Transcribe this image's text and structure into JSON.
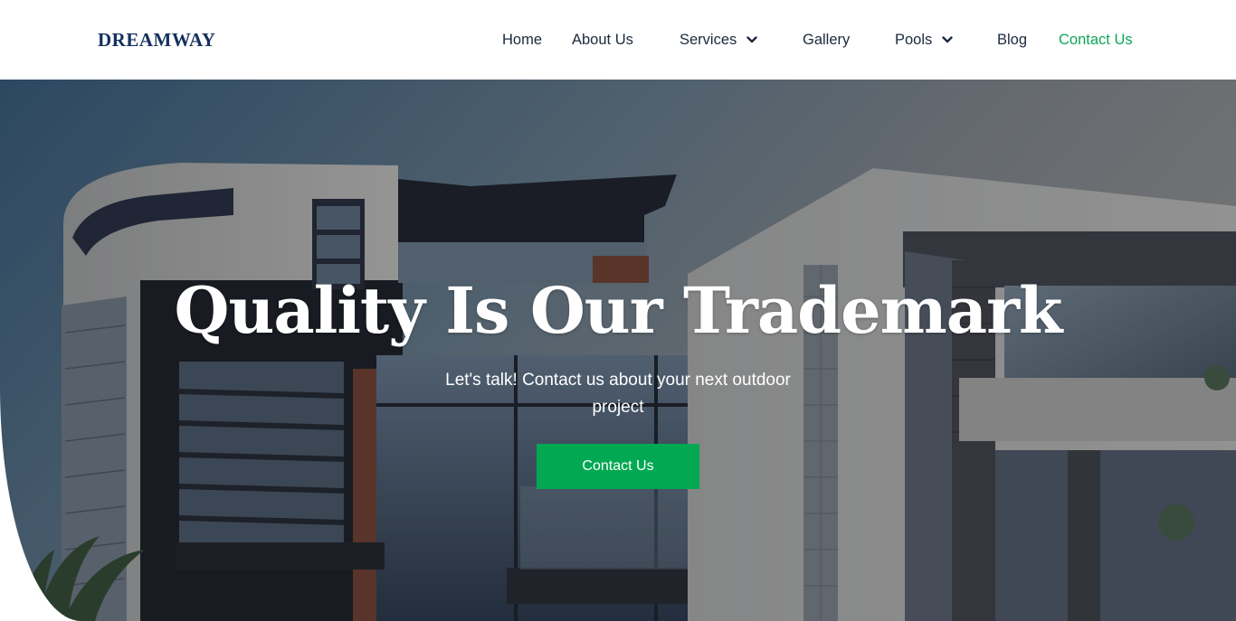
{
  "header": {
    "logo": "DREAMWAY",
    "nav": [
      {
        "label": "Home",
        "dropdown": false,
        "active": false
      },
      {
        "label": "About Us",
        "dropdown": false,
        "active": false
      },
      {
        "label": "Services",
        "dropdown": true,
        "active": false
      },
      {
        "label": "Gallery",
        "dropdown": false,
        "active": false
      },
      {
        "label": "Pools",
        "dropdown": true,
        "active": false
      },
      {
        "label": "Blog",
        "dropdown": false,
        "active": false
      },
      {
        "label": "Contact Us",
        "dropdown": false,
        "active": true
      }
    ],
    "dropdown_icon": "chevron-down-icon"
  },
  "hero": {
    "title": "Quality Is Our Trademark",
    "subtitle": "Let's talk! Contact us about your next outdoor project",
    "cta_label": "Contact Us",
    "background": "modern-house-photo"
  },
  "colors": {
    "brand": "#14305e",
    "accent": "#03a853",
    "active_link": "#0ea656",
    "nav_text": "#1b2a3d"
  }
}
